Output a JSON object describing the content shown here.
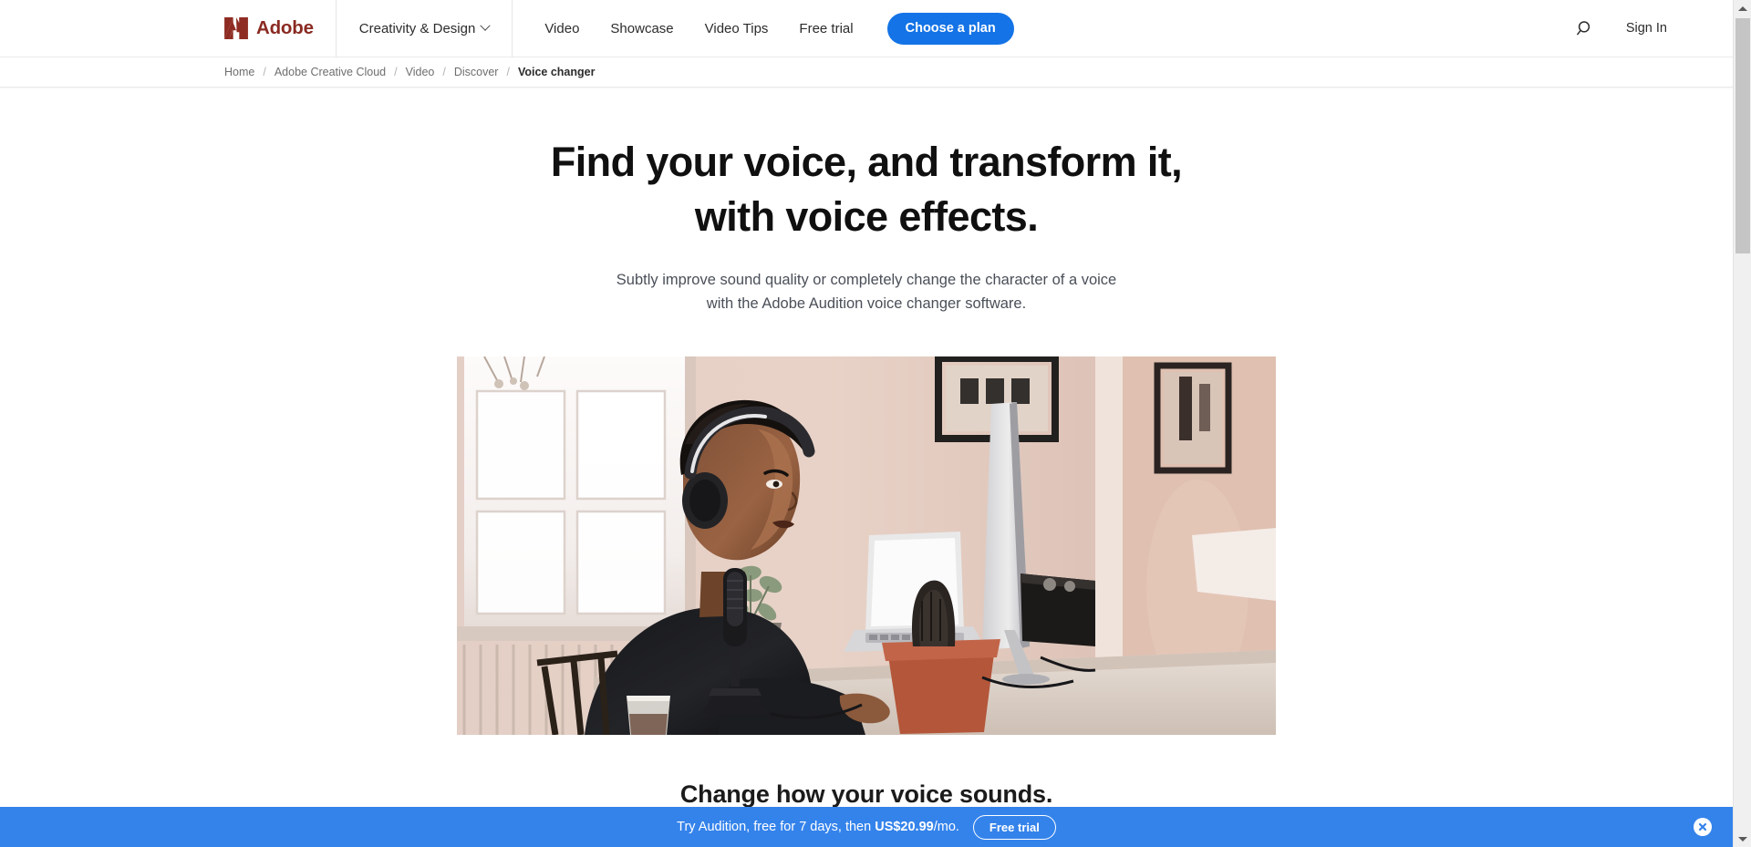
{
  "browser": {
    "scrollbar": {
      "up_arrow_icon": "triangle-up-icon",
      "down_arrow_icon": "triangle-down-icon",
      "thumb_label": "scroll-thumb"
    }
  },
  "global_nav": {
    "logo": {
      "icon": "adobe-a-mark-icon",
      "wordmark": "Adobe",
      "color": "#8a2a22"
    },
    "dropdown": {
      "label": "Creativity & Design",
      "chevron_icon": "chevron-down-icon"
    },
    "links": [
      {
        "label": "Video"
      },
      {
        "label": "Showcase"
      },
      {
        "label": "Video Tips"
      },
      {
        "label": "Free trial"
      }
    ],
    "cta": {
      "label": "Choose a plan",
      "color": "#1473e6"
    },
    "search": {
      "icon": "search-icon"
    },
    "sign_in": {
      "label": "Sign In"
    }
  },
  "breadcrumb": {
    "separator": "/",
    "items": [
      {
        "label": "Home",
        "current": false
      },
      {
        "label": "Adobe Creative Cloud",
        "current": false
      },
      {
        "label": "Video",
        "current": false
      },
      {
        "label": "Discover",
        "current": false
      },
      {
        "label": "Voice changer",
        "current": true
      }
    ]
  },
  "hero": {
    "title_line1": "Find your voice, and transform it,",
    "title_line2": "with voice effects.",
    "subtitle_line1": "Subtly improve sound quality or completely change the character of a voice",
    "subtitle_line2": "with the Adobe Audition voice changer software.",
    "image": {
      "alt": "Man wearing headphones speaking into a desktop microphone at a home-office desk with a laptop and iMac"
    }
  },
  "section": {
    "heading": "Change how your voice sounds."
  },
  "promo_banner": {
    "text_before": "Try Audition, free for 7 days, then ",
    "price": "US$20.99",
    "text_after": "/mo.",
    "button_label": "Free trial",
    "close_icon": "close-x-icon",
    "background": "#3483eb"
  }
}
